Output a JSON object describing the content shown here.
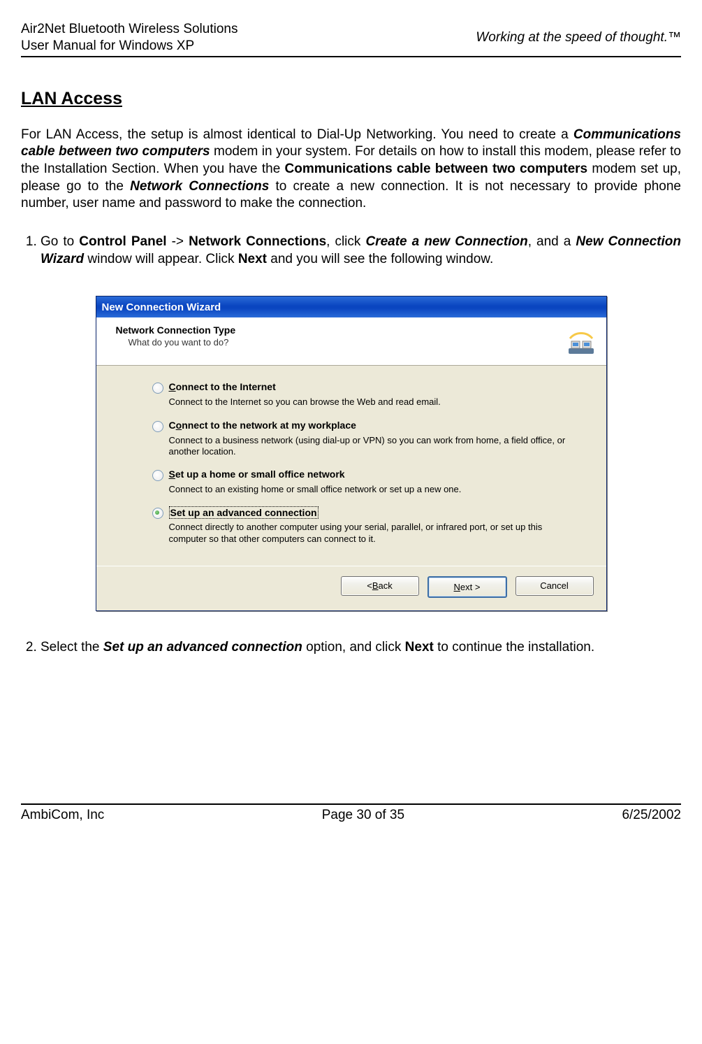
{
  "header": {
    "line1": "Air2Net Bluetooth Wireless Solutions",
    "line2": "User Manual for Windows XP",
    "right": "Working at the speed of thought.™"
  },
  "heading": "LAN Access",
  "para": {
    "p1a": "For LAN Access, the setup is almost identical to Dial-Up Networking. You need to create a ",
    "p1b": "Communications cable between two computers",
    "p1c": " modem in your system. For details on how to install this modem, please refer to the Installation Section. When you have the ",
    "p1d": "Communications cable between two computers",
    "p1e": " modem set up, please go to the ",
    "p1f": "Network Connections",
    "p1g": " to create a new connection. It is not necessary to provide phone number, user name and password to make the connection."
  },
  "step1": {
    "a": "Go to ",
    "b": "Control Panel",
    "c": " -> ",
    "d": "Network Connections",
    "e": ", click ",
    "f": "Create a new Connection",
    "g": ", and a ",
    "h": "New Connection Wizard",
    "i": " window will appear. Click ",
    "j": "Next",
    "k": " and you will see the following window."
  },
  "dialog": {
    "title": "New Connection Wizard",
    "header_title": "Network Connection Type",
    "header_sub": "What do you want to do?",
    "opt1": {
      "pre": "C",
      "label": "onnect to the Internet",
      "desc": "Connect to the Internet so you can browse the Web and read email."
    },
    "opt2": {
      "pre": "C",
      "label_u": "o",
      "label_rest": "nnect to the network at my workplace",
      "desc": "Connect to a business network (using dial-up or VPN) so you can work from home, a field office, or another location."
    },
    "opt3": {
      "pre": "S",
      "label": "et up a home or small office network",
      "desc": "Connect to an existing home or small office network or set up a new one."
    },
    "opt4": {
      "pre": "Set up an advanced connection",
      "desc": "Connect directly to another computer using your serial, parallel, or infrared port, or set up this computer so that other computers can connect to it."
    },
    "buttons": {
      "back_pre": "< ",
      "back_u": "B",
      "back_rest": "ack",
      "next_u": "N",
      "next_rest": "ext >",
      "cancel": "Cancel"
    }
  },
  "step2": {
    "a": "Select the ",
    "b": "Set up an advanced connection",
    "c": " option, and click ",
    "d": "Next",
    "e": " to continue the installation."
  },
  "footer": {
    "left": "AmbiCom, Inc",
    "center": "Page 30 of 35",
    "right": "6/25/2002"
  }
}
